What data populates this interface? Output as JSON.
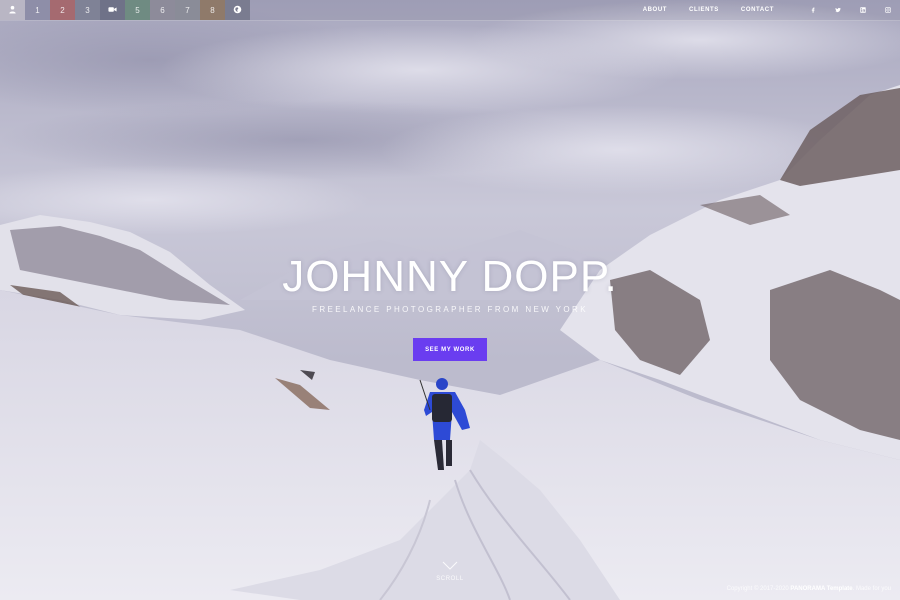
{
  "topbar": {
    "thumbs": [
      {
        "label": "",
        "icon": "person-icon",
        "bg": "#b9b6c4"
      },
      {
        "label": "1",
        "bg": "#8e8ea8"
      },
      {
        "label": "2",
        "bg": "#a56a70"
      },
      {
        "label": "3",
        "bg": "#7f8296"
      },
      {
        "label": "",
        "icon": "video-camera-icon",
        "bg": "#6f7288"
      },
      {
        "label": "5",
        "bg": "#6f8b82"
      },
      {
        "label": "6",
        "bg": "#8d8b9a"
      },
      {
        "label": "7",
        "bg": "#8a8c98"
      },
      {
        "label": "8",
        "bg": "#8f7a6a"
      },
      {
        "label": "",
        "icon": "globe-icon",
        "bg": "#7a7c90"
      }
    ],
    "nav": [
      "ABOUT",
      "CLIENTS",
      "CONTACT"
    ],
    "social": [
      "facebook-icon",
      "twitter-icon",
      "linkedin-icon",
      "instagram-icon"
    ]
  },
  "hero": {
    "title": "JOHNNY DOPP.",
    "subtitle": "FREELANCE PHOTOGRAPHER FROM NEW YORK",
    "cta_label": "SEE MY WORK",
    "scroll_label": "SCROLL"
  },
  "footer": {
    "prefix": "Copyright © 2017-2020 ",
    "brand": "PANORAMA Template",
    "suffix": ". Made for you"
  },
  "colors": {
    "accent": "#6a3df0",
    "sky": "#b7b5c9",
    "snow": "#e6e4ee"
  }
}
